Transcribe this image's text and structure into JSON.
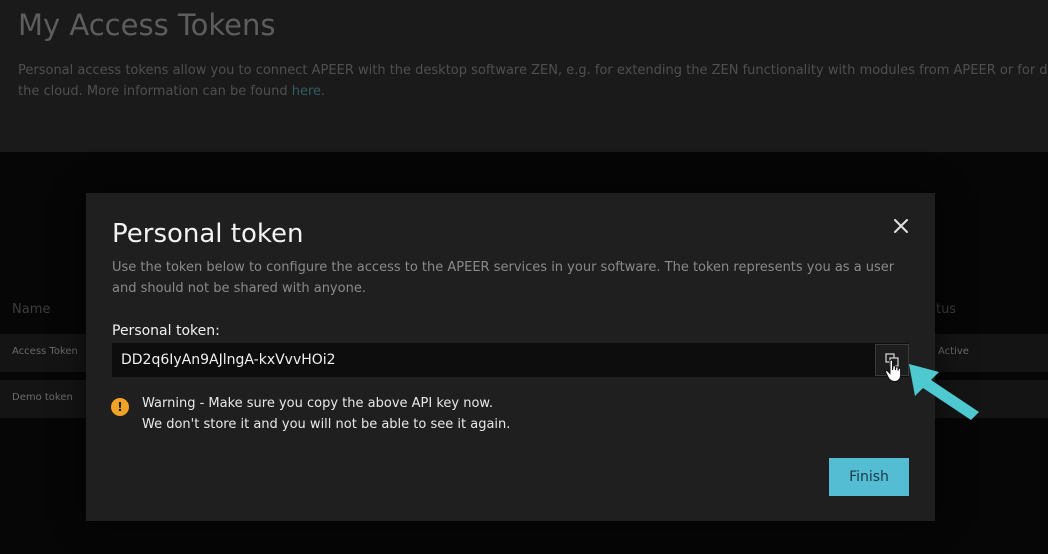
{
  "page": {
    "title": "My Access Tokens",
    "description": "Personal access tokens allow you to connect APEER with the desktop software ZEN, e.g. for extending the ZEN functionality with modules from APEER or for d",
    "description_line2": "the cloud. More information can be found ",
    "link": "here",
    "link_suffix": "."
  },
  "table": {
    "columns": [
      "Name",
      "atus"
    ],
    "rows": [
      {
        "name": "Access Token",
        "status": "Active"
      },
      {
        "name": "Demo token",
        "status": ""
      }
    ]
  },
  "modal": {
    "title": "Personal token",
    "description": "Use the token below to configure the access to the APEER services in your software. The token represents you as a user and should not be shared with anyone.",
    "token_label": "Personal token:",
    "token_value": "DD2q6IyAn9AJlngA-kxVvvHOi2",
    "warning_line1": "Warning - Make sure you copy the above API key now.",
    "warning_line2": "We don't store it and you will not be able to see it again.",
    "warning_icon_glyph": "!",
    "finish_label": "Finish",
    "icons": [
      "close-icon",
      "copy-icon",
      "warning-icon"
    ]
  },
  "colors": {
    "accent": "#55bdd3",
    "warning": "#f1a325",
    "annotation_arrow": "#4ec9cf"
  }
}
